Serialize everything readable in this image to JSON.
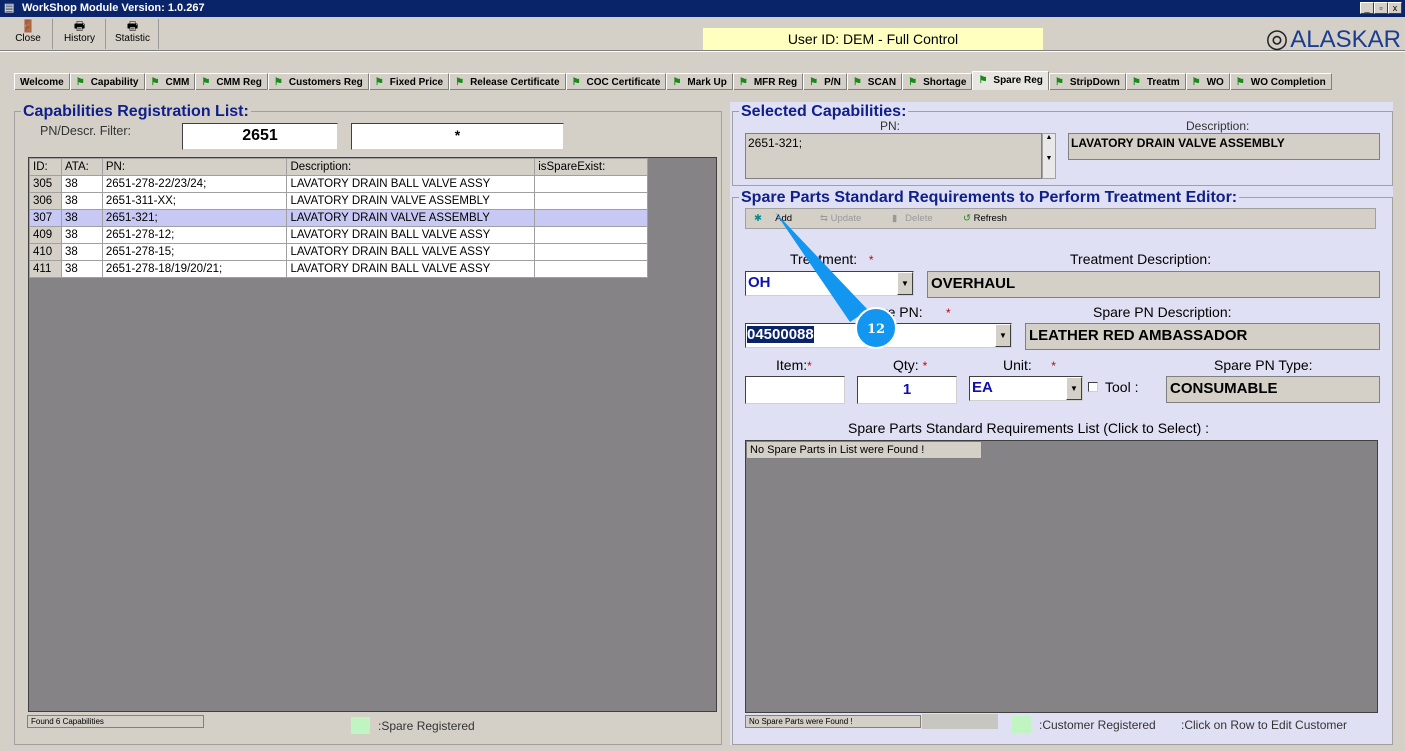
{
  "window": {
    "title": "WorkShop Module  Version: 1.0.267",
    "min": "_",
    "max": "▫",
    "close": "x"
  },
  "toolbar": [
    {
      "label": "Close",
      "icon": "exit-door-icon"
    },
    {
      "label": "History",
      "icon": "printer-icon"
    },
    {
      "label": "Statistic",
      "icon": "printer-icon"
    }
  ],
  "user_id": "User ID: DEM - Full Control",
  "logo": "ALASKAR",
  "tabs": [
    "Welcome",
    "Capability",
    "CMM",
    "CMM Reg",
    "Customers Reg",
    "Fixed Price",
    "Release Certificate",
    "COC Certificate",
    "Mark Up",
    "MFR Reg",
    "P/N",
    "SCAN",
    "Shortage",
    "Spare Reg",
    "StripDown",
    "Treatm",
    "WO",
    "WO Completion"
  ],
  "active_tab": "Spare Reg",
  "left": {
    "title": "Capabilities Registration List:",
    "filter_label": "PN/Descr. Filter:",
    "filter_pn": "2651",
    "filter_desc": "*",
    "columns": [
      "ID:",
      "ATA:",
      "PN:",
      "Description:",
      "isSpareExist:"
    ],
    "rows": [
      [
        "305",
        "38",
        "2651-278-22/23/24;",
        "LAVATORY DRAIN BALL VALVE ASSY",
        ""
      ],
      [
        "306",
        "38",
        "2651-311-XX;",
        "LAVATORY DRAIN VALVE ASSEMBLY",
        ""
      ],
      [
        "307",
        "38",
        "2651-321;",
        "LAVATORY DRAIN VALVE ASSEMBLY",
        ""
      ],
      [
        "409",
        "38",
        "2651-278-12;",
        "LAVATORY DRAIN BALL VALVE ASSY",
        ""
      ],
      [
        "410",
        "38",
        "2651-278-15;",
        "LAVATORY DRAIN BALL VALVE ASSY",
        ""
      ],
      [
        "411",
        "38",
        "2651-278-18/19/20/21;",
        "LAVATORY DRAIN BALL VALVE ASSY",
        ""
      ]
    ],
    "selected_row": 2,
    "status": "Found 6 Capabilities",
    "legend": ":Spare Registered",
    "legend_color": "#c0f4c0"
  },
  "selected": {
    "title": "Selected Capabilities:",
    "pn_label": "PN:",
    "pn": "2651-321;",
    "desc_label": "Description:",
    "desc": "LAVATORY DRAIN VALVE ASSEMBLY"
  },
  "editor": {
    "title": "Spare Parts Standard Requirements to Perform Treatment Editor:",
    "buttons": {
      "add": "Add",
      "update": "Update",
      "delete": "Delete",
      "refresh": "Refresh"
    },
    "treatment_label": "Treatment:",
    "treatment": "OH",
    "treatment_desc_label": "Treatment Description:",
    "treatment_desc": "OVERHAUL",
    "spare_pn_label": "Spare PN:",
    "spare_pn": "04500088",
    "spare_desc_label": "Spare PN Description:",
    "spare_desc": "LEATHER RED AMBASSADOR",
    "item_label": "Item:",
    "item": "",
    "qty_label": "Qty:",
    "qty": "1",
    "unit_label": "Unit:",
    "unit": "EA",
    "tool_label": "Tool :",
    "tool_checked": false,
    "type_label": "Spare PN Type:",
    "type": "CONSUMABLE",
    "required": "*",
    "list_title": "Spare Parts Standard Requirements List (Click to Select) :",
    "list_empty": "No Spare Parts in List were Found !",
    "status": "No Spare Parts were Found !",
    "legend": ":Customer Registered",
    "hint": ":Click on Row to Edit Customer"
  },
  "callout": {
    "number": "12",
    "color": "#1296f0"
  }
}
